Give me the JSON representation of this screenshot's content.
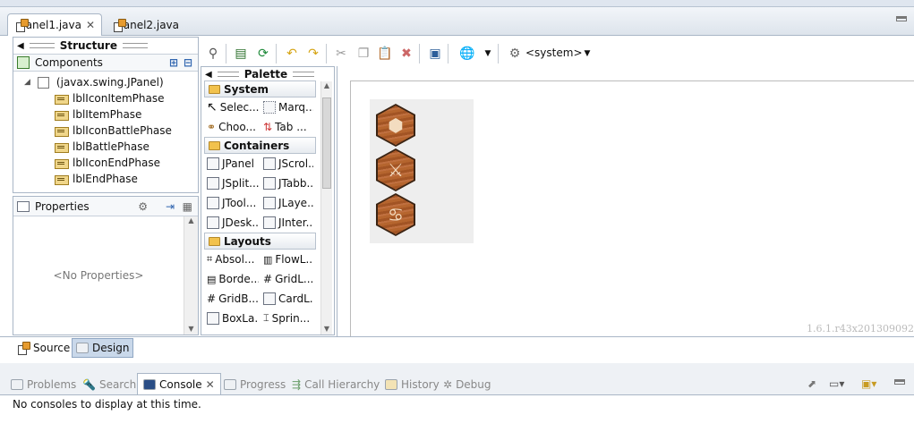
{
  "editor_tabs": [
    {
      "label": "Panel1.java",
      "active": true
    },
    {
      "label": "Panel2.java",
      "active": false
    }
  ],
  "structure": {
    "title": "Structure",
    "components_label": "Components",
    "tree_root": "(javax.swing.JPanel)",
    "tree_items": [
      "lblIconItemPhase",
      "lblItemPhase",
      "lblIconBattlePhase",
      "lblBattlePhase",
      "lblIconEndPhase",
      "lblEndPhase"
    ]
  },
  "properties": {
    "label": "Properties",
    "empty_text": "<No Properties>"
  },
  "toolbar": {
    "system_label": "<system>"
  },
  "palette": {
    "title": "Palette",
    "categories": [
      "System",
      "Containers",
      "Layouts"
    ],
    "system_items": [
      "Selec...",
      "Marq...",
      "Choo...",
      "Tab ..."
    ],
    "container_items": [
      "JPanel",
      "JScrol...",
      "JSplit...",
      "JTabb...",
      "JTool...",
      "JLaye...",
      "JDesk...",
      "JInter..."
    ],
    "layout_items": [
      "Absol...",
      "FlowL...",
      "Borde...",
      "GridL...",
      "GridB...",
      "CardL...",
      "BoxLa...",
      "Sprin..."
    ]
  },
  "canvas": {
    "version_text": "1.6.1.r43x201309092",
    "hex_icons": [
      "shield-like",
      "sword",
      "cancer-sign"
    ]
  },
  "mode_tabs": [
    {
      "label": "Source",
      "active": false
    },
    {
      "label": "Design",
      "active": true
    }
  ],
  "bottom_tabs": [
    {
      "label": "Problems",
      "active": false
    },
    {
      "label": "Search",
      "active": false
    },
    {
      "label": "Console",
      "active": true
    },
    {
      "label": "Progress",
      "active": false
    },
    {
      "label": "Call Hierarchy",
      "active": false
    },
    {
      "label": "History",
      "active": false
    },
    {
      "label": "Debug",
      "active": false
    }
  ],
  "console": {
    "message": "No consoles to display at this time."
  }
}
